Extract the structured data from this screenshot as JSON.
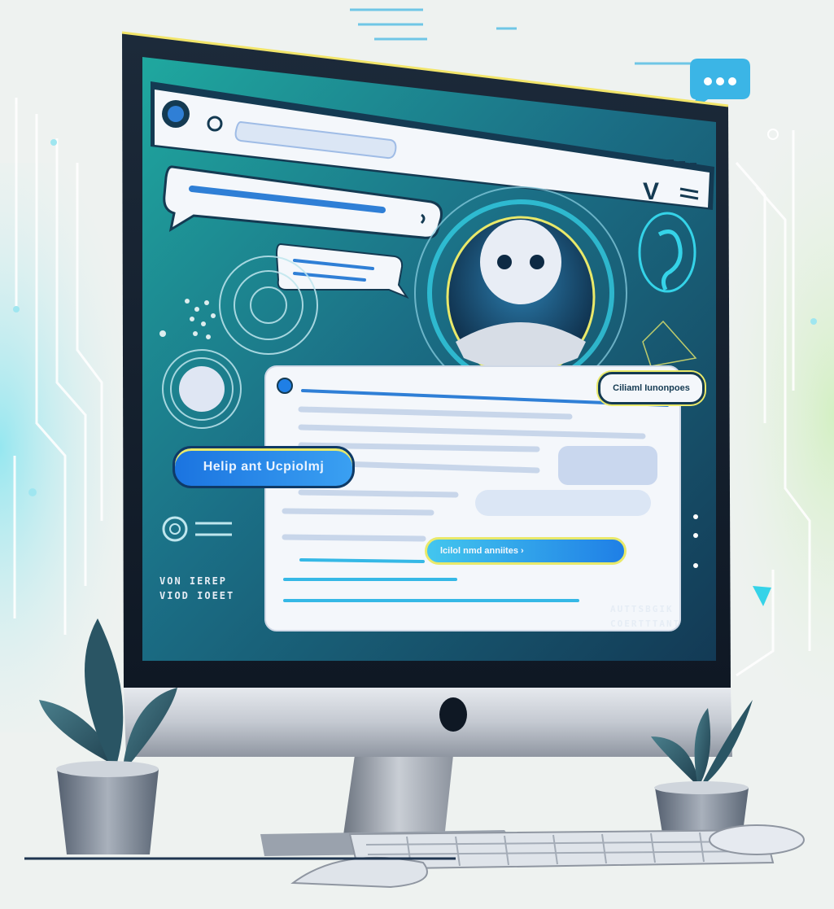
{
  "colors": {
    "background": "#eef2f0",
    "screen_teal": "#1f8f93",
    "screen_navy": "#143a52",
    "accent_blue": "#1f7fe6",
    "accent_cyan": "#35d3e8",
    "highlight_yellow": "#e9e96a",
    "panel_white": "#f4f7fb",
    "bezel": "#14202e",
    "stand_silver": "#b9bec6"
  },
  "browser": {
    "address_placeholder": ""
  },
  "buttons": {
    "help_label": "Helip ant Ucpiolmj",
    "small_tag_label": "Ciliaml Iunonpoes",
    "inner_chip_label": "lcilol nmd anniites ›"
  },
  "caption_left": {
    "line1": "VON IEREP",
    "line2": "VIOD IOEET"
  },
  "caption_right": {
    "line1": "AUTTSBGIK",
    "line2": "COERTTTANT"
  },
  "icons": {
    "chat_bubble": "chat-bubble-icon",
    "avatar": "robot-avatar-icon",
    "ear": "ear-icon",
    "browser_icon": "globe-icon",
    "menu": "hamburger-menu-icon"
  }
}
